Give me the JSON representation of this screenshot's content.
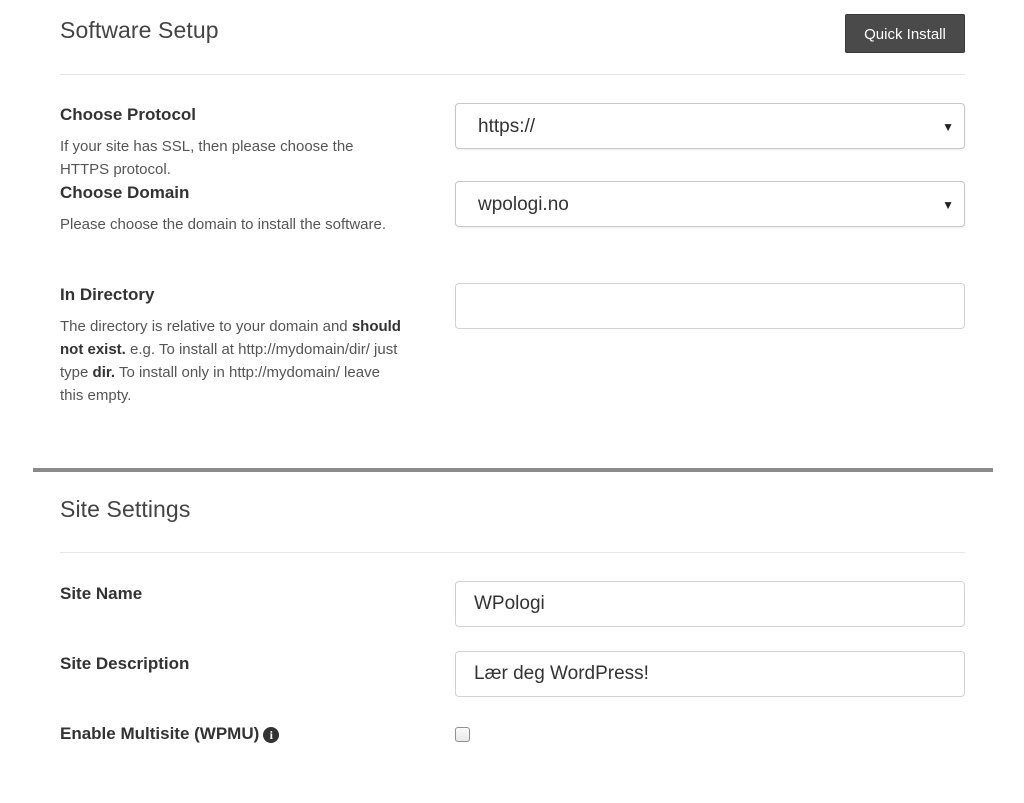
{
  "software_setup": {
    "title": "Software Setup",
    "quick_install_label": "Quick Install",
    "protocol": {
      "label": "Choose Protocol",
      "help": "If your site has SSL, then please choose the HTTPS protocol.",
      "value": "https://"
    },
    "domain": {
      "label": "Choose Domain",
      "help": "Please choose the domain to install the software.",
      "value": "wpologi.no"
    },
    "directory": {
      "label": "In Directory",
      "help_part1": "The directory is relative to your domain and ",
      "help_bold1": "should not exist.",
      "help_part2": " e.g. To install at http://mydomain/dir/ just type ",
      "help_bold2": "dir.",
      "help_part3": " To install only in http://mydomain/ leave this empty.",
      "value": ""
    }
  },
  "site_settings": {
    "title": "Site Settings",
    "site_name": {
      "label": "Site Name",
      "value": "WPologi"
    },
    "site_description": {
      "label": "Site Description",
      "value": "Lær deg WordPress!"
    },
    "multisite": {
      "label": "Enable Multisite (WPMU)",
      "info_icon": "info-circle-icon",
      "checked": false
    }
  },
  "colors": {
    "button_bg": "#4a4a4a",
    "section_divider": "#8a8a8a"
  }
}
